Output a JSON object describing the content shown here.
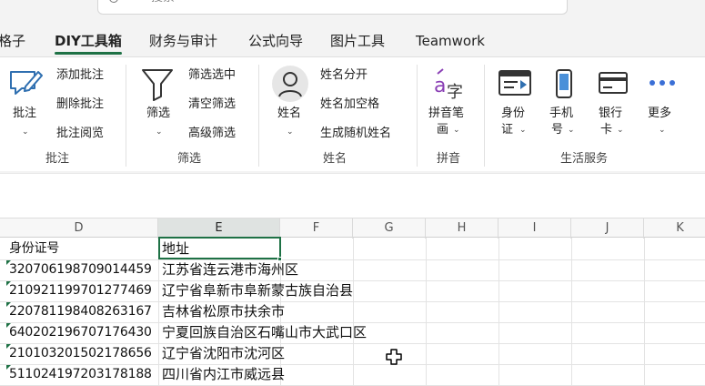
{
  "search": {
    "placeholder": "搜索"
  },
  "tabs": [
    "格子",
    "DIY工具箱",
    "财务与审计",
    "公式向导",
    "图片工具",
    "Teamwork"
  ],
  "active_tab": "DIY工具箱",
  "ribbon": {
    "annotation": {
      "big_button": "批注",
      "items": [
        "添加批注",
        "删除批注",
        "批注阅览"
      ],
      "group_label": "批注"
    },
    "filter": {
      "big_button": "筛选",
      "items": [
        "筛选选中",
        "清空筛选",
        "高级筛选"
      ],
      "group_label": "筛选"
    },
    "name": {
      "big_button": "姓名",
      "items": [
        "姓名分开",
        "姓名加空格",
        "生成随机姓名"
      ],
      "group_label": "姓名"
    },
    "pinyin": {
      "big_button_line1": "拼音笔",
      "big_button_line2": "画",
      "group_label": "拼音"
    },
    "life": {
      "buttons": [
        {
          "line1": "身份",
          "line2": "证"
        },
        {
          "line1": "手机",
          "line2": "号"
        },
        {
          "line1": "银行",
          "line2": "卡"
        },
        {
          "line1": "更多",
          "line2": ""
        }
      ],
      "group_label": "生活服务"
    }
  },
  "columns": [
    "D",
    "E",
    "F",
    "G",
    "H",
    "I",
    "J",
    "K"
  ],
  "selected_column": "E",
  "sheet": {
    "header": {
      "id": "身份证号",
      "address": "地址"
    },
    "rows": [
      {
        "id": "320706198709014459",
        "address": "江苏省连云港市海州区"
      },
      {
        "id": "210921199701277469",
        "address": "辽宁省阜新市阜新蒙古族自治县"
      },
      {
        "id": "220781198408263167",
        "address": "吉林省松原市扶余市"
      },
      {
        "id": "640202196707176430",
        "address": "宁夏回族自治区石嘴山市大武口区"
      },
      {
        "id": "210103201502178656",
        "address": "辽宁省沈阳市沈河区"
      },
      {
        "id": "511024197203178188",
        "address": "四川省内江市威远县"
      }
    ]
  },
  "colors": {
    "accent": "#1e7145",
    "ribbon_bg": "#ffffff",
    "band_bg": "#f3f3f3"
  }
}
